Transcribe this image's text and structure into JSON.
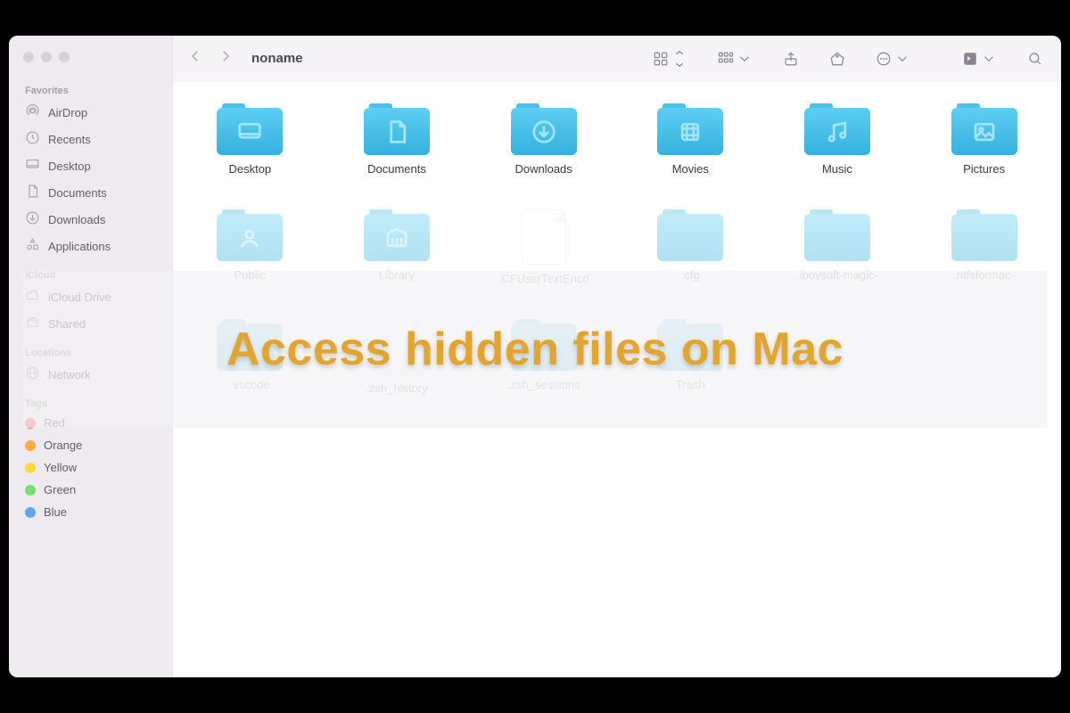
{
  "window": {
    "title": "noname"
  },
  "sidebar": {
    "favorites": {
      "header": "Favorites",
      "items": [
        {
          "label": "AirDrop",
          "icon": "airdrop"
        },
        {
          "label": "Recents",
          "icon": "clock"
        },
        {
          "label": "Desktop",
          "icon": "desktop"
        },
        {
          "label": "Documents",
          "icon": "doc"
        },
        {
          "label": "Downloads",
          "icon": "download"
        },
        {
          "label": "Applications",
          "icon": "apps"
        }
      ]
    },
    "icloud": {
      "header": "iCloud",
      "items": [
        {
          "label": "iCloud Drive",
          "icon": "cloud"
        },
        {
          "label": "Shared",
          "icon": "shared"
        }
      ]
    },
    "locations": {
      "header": "Locations",
      "items": [
        {
          "label": "Network",
          "icon": "globe"
        }
      ]
    },
    "tags": {
      "header": "Tags",
      "items": [
        {
          "label": "Red",
          "color": "#ff6b63"
        },
        {
          "label": "Orange",
          "color": "#ffab45"
        },
        {
          "label": "Yellow",
          "color": "#ffd93b"
        },
        {
          "label": "Green",
          "color": "#74e074"
        },
        {
          "label": "Blue",
          "color": "#5aa5ff"
        }
      ]
    }
  },
  "folders": [
    {
      "label": "Desktop",
      "icon": "desktop",
      "hidden": false,
      "type": "folder"
    },
    {
      "label": "Documents",
      "icon": "doc",
      "hidden": false,
      "type": "folder"
    },
    {
      "label": "Downloads",
      "icon": "download",
      "hidden": false,
      "type": "folder"
    },
    {
      "label": "Movies",
      "icon": "movie",
      "hidden": false,
      "type": "folder"
    },
    {
      "label": "Music",
      "icon": "music",
      "hidden": false,
      "type": "folder"
    },
    {
      "label": "Pictures",
      "icon": "picture",
      "hidden": false,
      "type": "folder"
    },
    {
      "label": "Public",
      "icon": "public",
      "hidden": true,
      "type": "folder"
    },
    {
      "label": "Library",
      "icon": "library",
      "hidden": true,
      "type": "folder"
    },
    {
      "label": ".CFUserTextEnco",
      "icon": "",
      "hidden": true,
      "type": "file"
    },
    {
      "label": ".cfg",
      "icon": "",
      "hidden": true,
      "type": "folder"
    },
    {
      "label": ".iboysoft-magic-",
      "icon": "",
      "hidden": true,
      "type": "folder"
    },
    {
      "label": ".ntfsformac-",
      "icon": "",
      "hidden": true,
      "type": "folder"
    },
    {
      "label": ".vscode",
      "icon": "",
      "hidden": true,
      "type": "folder"
    },
    {
      "label": ".zsh_history",
      "icon": "",
      "hidden": true,
      "type": "file"
    },
    {
      "label": ".zsh_sessions",
      "icon": "",
      "hidden": true,
      "type": "folder"
    },
    {
      "label": "Trash",
      "icon": "",
      "hidden": true,
      "type": "folder"
    }
  ],
  "banner": {
    "text": "Access hidden files on Mac"
  }
}
